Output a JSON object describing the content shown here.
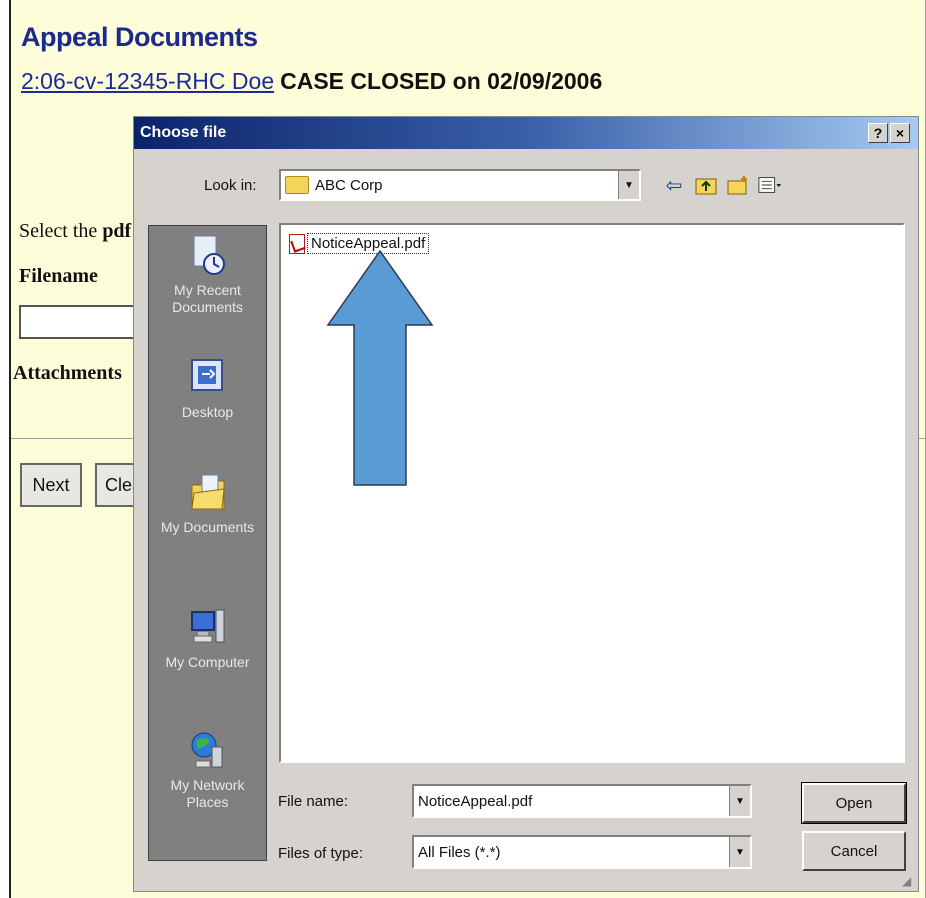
{
  "page": {
    "title": "Appeal Documents",
    "case_link": "2:06-cv-12345-RHC Doe",
    "case_status": "CASE CLOSED on 02/09/2006",
    "select_prefix": "Select the ",
    "select_bold": "pdf",
    "filename_label": "Filename",
    "attachments_label": "Attachments",
    "next_button": "Next",
    "clear_button": "Clea"
  },
  "dialog": {
    "title": "Choose file",
    "help_button": "?",
    "close_button": "×",
    "look_in_label": "Look in:",
    "look_in_value": "ABC Corp",
    "places": [
      {
        "label": "My Recent Documents",
        "icon": "recent-documents-icon"
      },
      {
        "label": "Desktop",
        "icon": "desktop-icon"
      },
      {
        "label": "My Documents",
        "icon": "my-documents-icon"
      },
      {
        "label": "My Computer",
        "icon": "my-computer-icon"
      },
      {
        "label": "My Network Places",
        "icon": "network-places-icon"
      }
    ],
    "files": [
      {
        "name": "NoticeAppeal.pdf",
        "icon": "pdf-file-icon"
      }
    ],
    "file_name_label": "File name:",
    "file_name_value": "NoticeAppeal.pdf",
    "file_type_label": "Files of type:",
    "file_type_value": "All Files (*.*)",
    "open_button": "Open",
    "cancel_button": "Cancel"
  },
  "annotation": {
    "arrow_color": "#5b9bd5",
    "arrow_outline": "#2e3a4c"
  },
  "colors": {
    "page_background": "#fdfdd9",
    "title_blue": "#1c2a8c",
    "titlebar_dark": "#0a246a",
    "titlebar_light": "#a6caf0",
    "dialog_gray": "#d6d3ce"
  }
}
